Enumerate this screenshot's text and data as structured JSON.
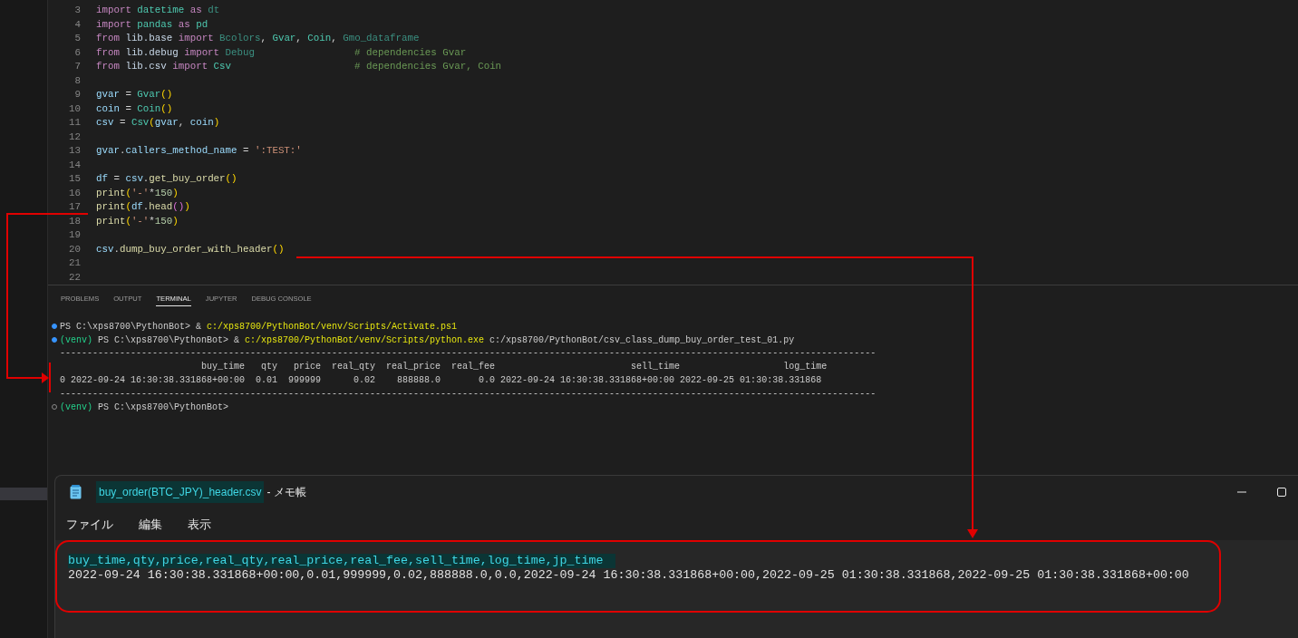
{
  "editor": {
    "lines": [
      {
        "number": "3",
        "tokens": [
          {
            "text": "import",
            "kind": "keyword"
          },
          {
            "text": " datetime",
            "kind": "module"
          },
          {
            "text": " as",
            "kind": "keyword"
          },
          {
            "text": " dt",
            "kind": "module_dim"
          }
        ]
      },
      {
        "number": "4",
        "tokens": [
          {
            "text": "import",
            "kind": "keyword"
          },
          {
            "text": " pandas",
            "kind": "module"
          },
          {
            "text": " as",
            "kind": "keyword"
          },
          {
            "text": " pd",
            "kind": "module"
          }
        ]
      },
      {
        "number": "5",
        "tokens": [
          {
            "text": "from",
            "kind": "keyword"
          },
          {
            "text": " lib.base",
            "kind": "path"
          },
          {
            "text": " import",
            "kind": "keyword"
          },
          {
            "text": " Bcolors",
            "kind": "module_dim"
          },
          {
            "text": ",",
            "kind": "plain"
          },
          {
            "text": " Gvar",
            "kind": "module"
          },
          {
            "text": ",",
            "kind": "plain"
          },
          {
            "text": " Coin",
            "kind": "module"
          },
          {
            "text": ",",
            "kind": "plain"
          },
          {
            "text": " Gmo_dataframe",
            "kind": "module_dim"
          }
        ]
      },
      {
        "number": "6",
        "tokens": [
          {
            "text": "from",
            "kind": "keyword"
          },
          {
            "text": " lib.debug",
            "kind": "path"
          },
          {
            "text": " import",
            "kind": "keyword"
          },
          {
            "text": " Debug",
            "kind": "module_dim"
          },
          {
            "text": "                 # dependencies Gvar",
            "kind": "comment"
          }
        ]
      },
      {
        "number": "7",
        "tokens": [
          {
            "text": "from",
            "kind": "keyword"
          },
          {
            "text": " lib.csv",
            "kind": "path"
          },
          {
            "text": " import",
            "kind": "keyword"
          },
          {
            "text": " Csv",
            "kind": "module"
          },
          {
            "text": "                     # dependencies Gvar, Coin",
            "kind": "comment"
          }
        ]
      },
      {
        "number": "8"
      },
      {
        "number": "9",
        "tokens": [
          {
            "text": "gvar",
            "kind": "variable"
          },
          {
            "text": " =",
            "kind": "plain"
          },
          {
            "text": " Gvar",
            "kind": "module"
          },
          {
            "text": "()",
            "kind": "bracket"
          }
        ]
      },
      {
        "number": "10",
        "tokens": [
          {
            "text": "coin",
            "kind": "variable"
          },
          {
            "text": " =",
            "kind": "plain"
          },
          {
            "text": " Coin",
            "kind": "module"
          },
          {
            "text": "()",
            "kind": "bracket"
          }
        ]
      },
      {
        "number": "11",
        "tokens": [
          {
            "text": "csv",
            "kind": "variable"
          },
          {
            "text": " =",
            "kind": "plain"
          },
          {
            "text": " Csv",
            "kind": "module"
          },
          {
            "text": "(",
            "kind": "bracket"
          },
          {
            "text": "gvar",
            "kind": "variable"
          },
          {
            "text": ",",
            "kind": "plain"
          },
          {
            "text": " coin",
            "kind": "variable"
          },
          {
            "text": ")",
            "kind": "bracket"
          }
        ]
      },
      {
        "number": "12"
      },
      {
        "number": "13",
        "tokens": [
          {
            "text": "gvar",
            "kind": "variable"
          },
          {
            "text": ".",
            "kind": "plain"
          },
          {
            "text": "callers_method_name",
            "kind": "variable"
          },
          {
            "text": " =",
            "kind": "plain"
          },
          {
            "text": " ':TEST:'",
            "kind": "string"
          }
        ]
      },
      {
        "number": "14"
      },
      {
        "number": "15",
        "tokens": [
          {
            "text": "df",
            "kind": "variable"
          },
          {
            "text": " =",
            "kind": "plain"
          },
          {
            "text": " csv",
            "kind": "variable"
          },
          {
            "text": ".",
            "kind": "plain"
          },
          {
            "text": "get_buy_order",
            "kind": "function"
          },
          {
            "text": "()",
            "kind": "bracket"
          }
        ]
      },
      {
        "number": "16",
        "tokens": [
          {
            "text": "print",
            "kind": "function"
          },
          {
            "text": "(",
            "kind": "bracket"
          },
          {
            "text": "'-'",
            "kind": "string"
          },
          {
            "text": "*",
            "kind": "plain"
          },
          {
            "text": "150",
            "kind": "number"
          },
          {
            "text": ")",
            "kind": "bracket"
          }
        ]
      },
      {
        "number": "17",
        "tokens": [
          {
            "text": "print",
            "kind": "function"
          },
          {
            "text": "(",
            "kind": "bracket"
          },
          {
            "text": "df",
            "kind": "variable"
          },
          {
            "text": ".",
            "kind": "plain"
          },
          {
            "text": "head",
            "kind": "function"
          },
          {
            "text": "()",
            "kind": "bracket2"
          },
          {
            "text": ")",
            "kind": "bracket"
          }
        ]
      },
      {
        "number": "18",
        "tokens": [
          {
            "text": "print",
            "kind": "function"
          },
          {
            "text": "(",
            "kind": "bracket"
          },
          {
            "text": "'-'",
            "kind": "string"
          },
          {
            "text": "*",
            "kind": "plain"
          },
          {
            "text": "150",
            "kind": "number"
          },
          {
            "text": ")",
            "kind": "bracket"
          }
        ]
      },
      {
        "number": "19"
      },
      {
        "number": "20",
        "tokens": [
          {
            "text": "csv",
            "kind": "variable"
          },
          {
            "text": ".",
            "kind": "plain"
          },
          {
            "text": "dump_buy_order_with_header",
            "kind": "function"
          },
          {
            "text": "()",
            "kind": "bracket"
          }
        ]
      },
      {
        "number": "21"
      },
      {
        "number": "22"
      }
    ]
  },
  "panel": {
    "tabs": [
      {
        "label": "PROBLEMS",
        "selected": false
      },
      {
        "label": "OUTPUT",
        "selected": false
      },
      {
        "label": "TERMINAL",
        "selected": true
      },
      {
        "label": "JUPYTER",
        "selected": false
      },
      {
        "label": "DEBUG CONSOLE",
        "selected": false
      }
    ],
    "terminal": [
      {
        "kind": "command",
        "done": true,
        "segments": [
          {
            "text": "PS C:\\xps8700\\PythonBot> & ",
            "kind": "plain"
          },
          {
            "text": "c:/xps8700/PythonBot/venv/Scripts/Activate.ps1",
            "kind": "path"
          }
        ]
      },
      {
        "kind": "command",
        "done": true,
        "segments": [
          {
            "text": "(venv)",
            "kind": "env"
          },
          {
            "text": " PS C:\\xps8700\\PythonBot> & ",
            "kind": "plain"
          },
          {
            "text": "c:/xps8700/PythonBot/venv/Scripts/python.exe",
            "kind": "path"
          },
          {
            "text": " c:/xps8700/PythonBot/csv_class_dump_buy_order_test_01.py",
            "kind": "plain"
          }
        ]
      },
      {
        "kind": "output",
        "text": "------------------------------------------------------------------------------------------------------------------------------------------------------"
      },
      {
        "kind": "output",
        "text": "                          buy_time   qty   price  real_qty  real_price  real_fee                         sell_time                   log_time"
      },
      {
        "kind": "output",
        "text": "0 2022-09-24 16:30:38.331868+00:00  0.01  999999      0.02    888888.0       0.0 2022-09-24 16:30:38.331868+00:00 2022-09-25 01:30:38.331868"
      },
      {
        "kind": "output",
        "text": "------------------------------------------------------------------------------------------------------------------------------------------------------"
      },
      {
        "kind": "command",
        "done": false,
        "segments": [
          {
            "text": "(venv)",
            "kind": "env"
          },
          {
            "text": " PS C:\\xps8700\\PythonBot>",
            "kind": "plain"
          }
        ]
      }
    ]
  },
  "notepad": {
    "file_name": "buy_order(BTC_JPY)_header.csv",
    "app_name": "- メモ帳",
    "menu": [
      "ファイル",
      "編集",
      "表示"
    ],
    "lines": [
      {
        "text": "buy_time,qty,price,real_qty,real_price,real_fee,sell_time,log_time,jp_time",
        "selected": true
      },
      {
        "text": "2022-09-24 16:30:38.331868+00:00,0.01,999999,0.02,888888.0,0.0,2022-09-24 16:30:38.331868+00:00,2022-09-25 01:30:38.331868,2022-09-25 01:30:38.331868+00:00",
        "selected": false
      }
    ]
  }
}
